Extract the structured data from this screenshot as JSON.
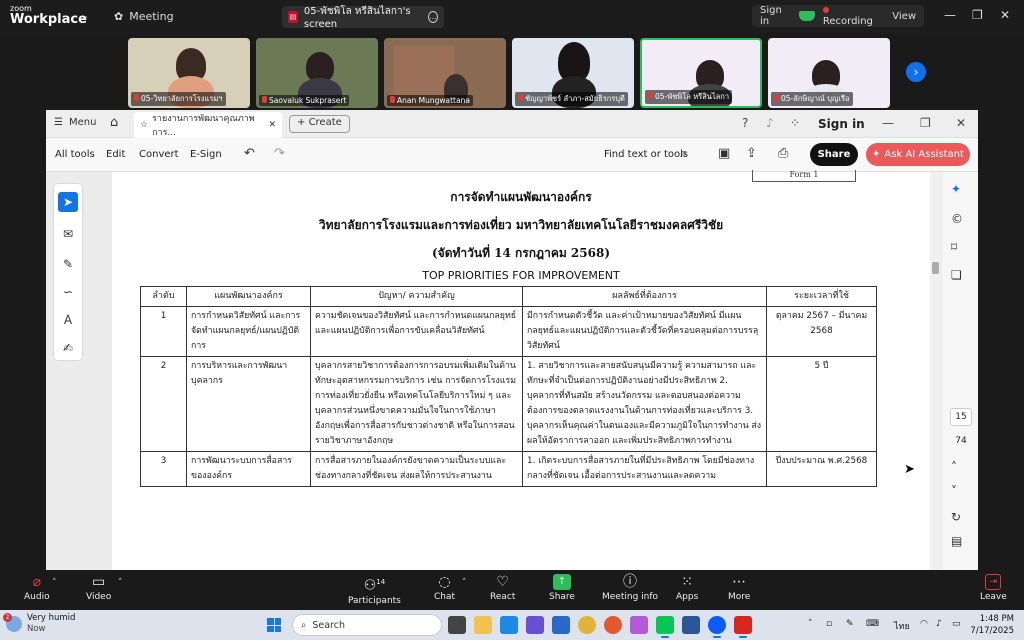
{
  "zoom": {
    "brand_top": "zoom",
    "brand": "Workplace",
    "meeting_label": "Meeting",
    "share_tab": "05-พัชพิโล หรีสินไลกา's screen",
    "signin": "Sign in",
    "recording": "Recording",
    "view": "View",
    "window_controls": {
      "minimize": "—",
      "restore": "❐",
      "close": "✕"
    }
  },
  "participants": [
    {
      "name": "05-วิทยาลัยการโรงแรมฯ",
      "bg": "#d8cfb8"
    },
    {
      "name": "Saovaluk Sukprasert",
      "bg": "#6b7a55"
    },
    {
      "name": "Anan Mungwattana",
      "bg": "#8a6c54"
    },
    {
      "name": "ชัญญาพัชร์ ลำภา-สมัยธิรกรบุตี",
      "bg": "#dfe6ef"
    },
    {
      "name": "05-พัชพิโล หรีสินไลกา",
      "bg": "#f2ecf6"
    },
    {
      "name": "05-ลักษิญาณ์ บุญเรือ",
      "bg": "#f2ecf6"
    }
  ],
  "acrobat": {
    "menu": "Menu",
    "doc_tab": "รายงานการพัฒนาคุณภาพการ...",
    "create": "Create",
    "signin": "Sign in",
    "tools": [
      "All tools",
      "Edit",
      "Convert",
      "E-Sign"
    ],
    "find": "Find text or tools",
    "share": "Share",
    "ai": "Ask AI Assistant",
    "page_current": "15",
    "page_total": "74"
  },
  "document": {
    "form_label": "Form 1",
    "title": "การจัดทำแผนพัฒนาองค์กร",
    "subtitle": "วิทยาลัยการโรงแรมและการท่องเที่ยว มหาวิทยาลัยเทคโนโลยีราชมงคลศรีวิชัย",
    "date": "(จัดทำวันที่ 14 กรกฎาคม 2568)",
    "section": "TOP PRIORITIES FOR IMPROVEMENT",
    "headers": [
      "ลำดับ",
      "แผนพัฒนาองค์กร",
      "ปัญหา/ ความสำคัญ",
      "ผลลัพธ์ที่ต้องการ",
      "ระยะเวลาที่ใช้"
    ],
    "rows": [
      {
        "no": "1",
        "plan": "การกำหนดวิสัยทัศน์ และการจัดทำแผนกลยุทธ์/แผนปฏิบัติการ",
        "problem": "ความชัดเจนของวิสัยทัศน์ และการกำหนดแผนกลยุทธ์และแผนปฏิบัติการเพื่อการขับเคลื่อนวิสัยทัศน์",
        "result": "มีการกำหนดตัวชี้วัด และค่าเป้าหมายของวิสัยทัศน์ มีแผนกลยุทธ์และแผนปฏิบัติการและตัวชี้วัดที่ครอบคลุมต่อการบรรลุวิสัยทัศน์",
        "time": "ตุลาคม 2567 – มีนาคม 2568"
      },
      {
        "no": "2",
        "plan": "การบริหารและการพัฒนาบุคลากร",
        "problem": "บุคลากรสายวิชาการต้องการการอบรมเพิ่มเติมในด้านทักษะอุตสาหกรรมการบริการ เช่น การจัดการโรงแรม การท่องเที่ยวยั่งยืน หรือเทคโนโลยีบริการใหม่ ๆ และบุคลากรส่วนหนึ่งขาดความมั่นใจในการใช้ภาษาอังกฤษเพื่อการสื่อสารกับชาวต่างชาติ หรือในการสอนรายวิชาภาษาอังกฤษ",
        "result": "1. สายวิชาการและสายสนับสนุนมีความรู้ ความสามารถ และทักษะที่จำเป็นต่อการปฏิบัติงานอย่างมีประสิทธิภาพ 2. บุคลากรที่ทันสมัย สร้างนวัตกรรม และตอบสนองต่อความต้องการของตลาดแรงงานในด้านการท่องเที่ยวและบริการ 3. บุคลากรเห็นคุณค่าในตนเองและมีความภูมิใจในการทำงาน ส่งผลให้อัตราการลาออก และเพิ่มประสิทธิภาพการทำงาน",
        "time": "5 ปี"
      },
      {
        "no": "3",
        "plan": "การพัฒนาระบบการสื่อสารขององค์กร",
        "problem": "การสื่อสารภายในองค์กรยังขาดความเป็นระบบและช่องทางกลางที่ชัดเจน ส่งผลให้การประสานงาน",
        "result": "1. เกิดระบบการสื่อสารภายในที่มีประสิทธิภาพ โดยมีช่องทางกลางที่ชัดเจน เอื้อต่อการประสานงานและลดความ",
        "time": "ปีงบประมาณ พ.ศ.2568"
      }
    ]
  },
  "zoom_controls": {
    "audio": "Audio",
    "video": "Video",
    "participants": "Participants",
    "participants_count": "14",
    "chat": "Chat",
    "react": "React",
    "share": "Share",
    "meeting_info": "Meeting info",
    "apps": "Apps",
    "more": "More",
    "leave": "Leave"
  },
  "taskbar": {
    "weather_count": "2",
    "weather": "Very humid",
    "weather_sub": "Now",
    "search": "Search",
    "lang": "ไทย",
    "time": "1:48 PM",
    "date": "7/17/2025"
  }
}
